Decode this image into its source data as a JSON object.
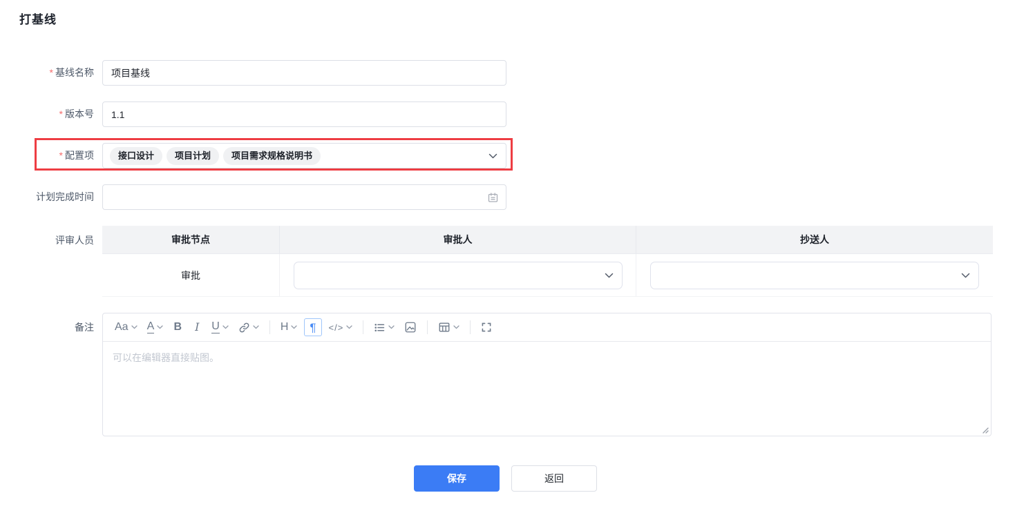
{
  "page": {
    "title": "打基线"
  },
  "form": {
    "required_marker": "*",
    "fields": {
      "baseline_name": {
        "label": "基线名称",
        "value": "项目基线",
        "required": true
      },
      "version": {
        "label": "版本号",
        "value": "1.1",
        "required": true
      },
      "config_items": {
        "label": "配置项",
        "required": true,
        "tags": [
          "接口设计",
          "项目计划",
          "项目需求规格说明书"
        ],
        "highlighted": true
      },
      "plan_finish_time": {
        "label": "计划完成时间",
        "value": "",
        "required": false
      }
    },
    "reviewers": {
      "label": "评审人员",
      "headers": [
        "审批节点",
        "审批人",
        "抄送人"
      ],
      "rows": [
        {
          "node": "审批",
          "approver": "",
          "cc": ""
        }
      ]
    },
    "remark": {
      "label": "备注",
      "placeholder": "可以在编辑器直接贴图。",
      "toolbar": {
        "font_size": "Aa",
        "font_color": "A",
        "bold": "B",
        "italic": "I",
        "underline": "U",
        "link": "link-icon",
        "heading": "H",
        "paragraph": "¶",
        "code": "</>",
        "list": "list-icon",
        "image": "image-icon",
        "table": "table-icon",
        "fullscreen": "fullscreen-icon"
      },
      "active_tool": "paragraph"
    }
  },
  "actions": {
    "save": "保存",
    "back": "返回"
  },
  "colors": {
    "primary_blue": "#3b7cf5",
    "highlight_red": "#ee3d43",
    "required_red": "#f56c6c",
    "table_header_bg": "#f2f3f5",
    "tag_bg": "#f0f1f3",
    "placeholder_gray": "#c2c7d0"
  }
}
